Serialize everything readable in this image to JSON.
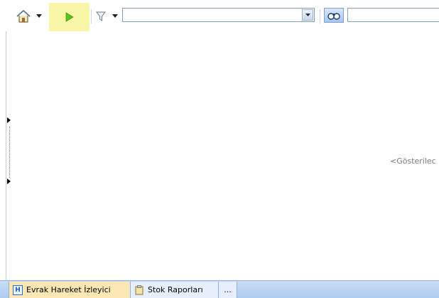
{
  "toolbar": {
    "icons": {
      "home": "home-icon",
      "dropdown": "chevron-down-icon",
      "play": "play-icon",
      "filter": "filter-icon",
      "search": "binoculars-icon"
    },
    "filter_combo": {
      "value": "",
      "placeholder": ""
    },
    "search_field": {
      "value": "",
      "placeholder": ""
    },
    "highlight_color": "#f9f7a7"
  },
  "content": {
    "placeholder_text": "<Gösterilec"
  },
  "tabs": [
    {
      "label": "Evrak Hareket İzleyici",
      "icon": "tracker-icon",
      "active": true
    },
    {
      "label": "Stok Raporları",
      "icon": "clipboard-icon",
      "active": false
    },
    {
      "label": "...",
      "icon": "",
      "active": false
    }
  ],
  "colors": {
    "accent": "#2a6fcf",
    "tab_active": "#fbe7b4",
    "tabbar": "#aecbf0",
    "play_green": "#5dc21e"
  }
}
